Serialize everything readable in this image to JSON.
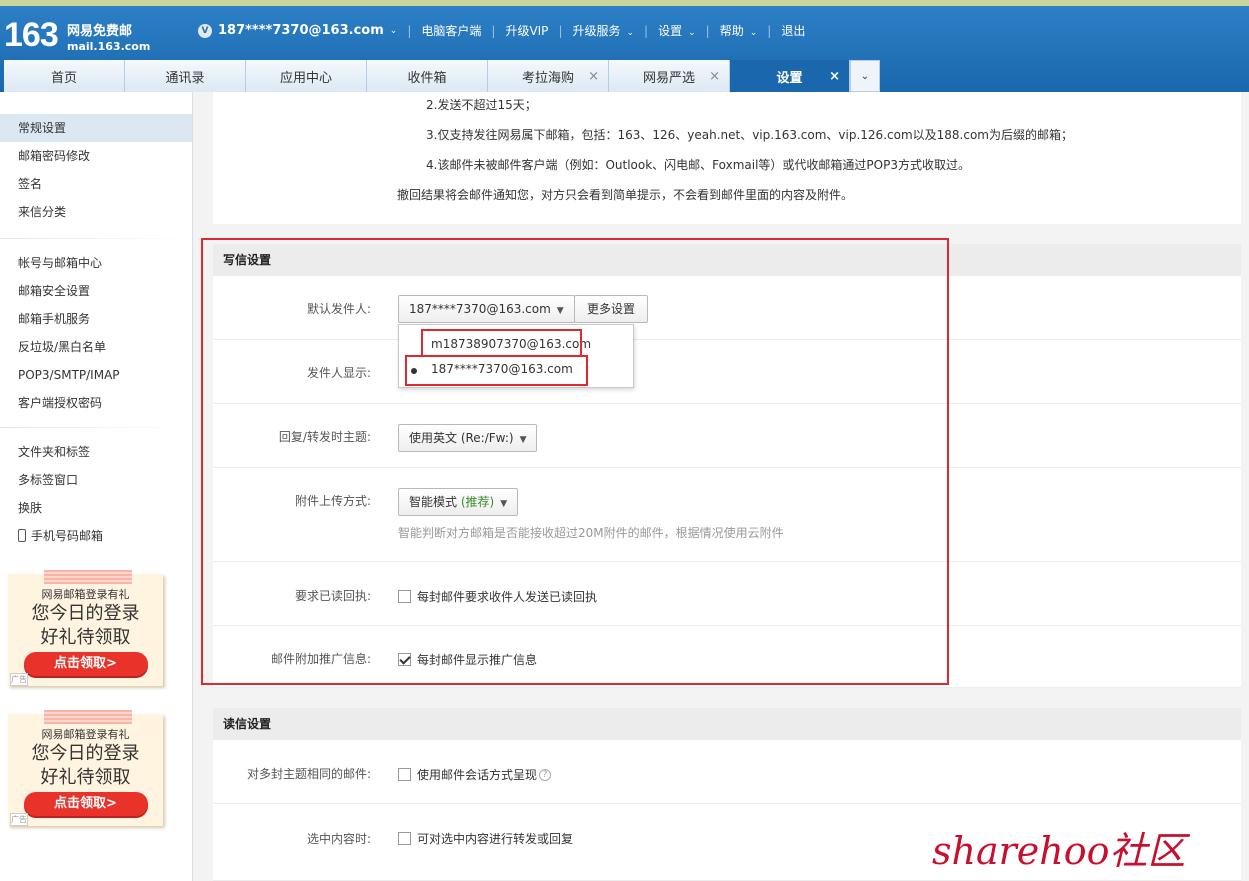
{
  "header": {
    "logo_num": "163",
    "logo_line1": "网易免费邮",
    "logo_line2": "mail.163.com",
    "vip_badge": "V",
    "account": "187****7370@163.com",
    "links": [
      "电脑客户端",
      "升级VIP",
      "升级服务",
      "设置",
      "帮助",
      "退出"
    ]
  },
  "tabs": [
    {
      "label": "首页",
      "closable": false
    },
    {
      "label": "通讯录",
      "closable": false
    },
    {
      "label": "应用中心",
      "closable": false
    },
    {
      "label": "收件箱",
      "closable": false
    },
    {
      "label": "考拉海购",
      "closable": true
    },
    {
      "label": "网易严选",
      "closable": true
    },
    {
      "label": "设置",
      "closable": true,
      "active": true
    }
  ],
  "tab_close_glyph": "×",
  "sidebar": {
    "group1": [
      "常规设置",
      "邮箱密码修改",
      "签名",
      "来信分类"
    ],
    "group2": [
      "帐号与邮箱中心",
      "邮箱安全设置",
      "邮箱手机服务",
      "反垃圾/黑白名单",
      "POP3/SMTP/IMAP",
      "客户端授权密码"
    ],
    "group3": [
      "文件夹和标签",
      "多标签窗口",
      "换肤",
      "手机号码邮箱"
    ]
  },
  "ads": [
    {
      "line1": "网易邮箱登录有礼",
      "line2": "您今日的登录",
      "line3": "好礼待领取",
      "button": "点击领取>",
      "tag": "广告"
    },
    {
      "line1": "网易邮箱登录有礼",
      "line2": "您今日的登录",
      "line3": "好礼待领取",
      "button": "点击领取>",
      "tag": "广告"
    }
  ],
  "recall_notes": {
    "n2": "2.发送不超过15天；",
    "n3": "3.仅支持发往网易属下邮箱，包括：163、126、yeah.net、vip.163.com、vip.126.com以及188.com为后缀的邮箱；",
    "n4": "4.该邮件未被邮件客户端（例如：Outlook、闪电邮、Foxmail等）或代收邮箱通过POP3方式收取过。",
    "summary": "撤回结果将会邮件通知您，对方只会看到简单提示，不会看到邮件里面的内容及附件。"
  },
  "compose": {
    "title": "写信设置",
    "default_sender_label": "默认发件人:",
    "default_sender_value": "187****7370@163.com",
    "more_settings": "更多设置",
    "sender_display_label": "发件人显示:",
    "dropdown_options": [
      "m18738907370@163.com",
      "187****7370@163.com"
    ],
    "reply_subject_label": "回复/转发时主题:",
    "reply_subject_value": "使用英文 (Re:/Fw:)",
    "attach_label": "附件上传方式:",
    "attach_value": "智能模式",
    "attach_recommend": "(推荐)",
    "attach_hint": "智能判断对方邮箱是否能接收超过20M附件的邮件，根据情况使用云附件",
    "receipt_label": "要求已读回执:",
    "receipt_text": "每封邮件要求收件人发送已读回执",
    "receipt_checked": false,
    "promo_label": "邮件附加推广信息:",
    "promo_text": "每封邮件显示推广信息",
    "promo_checked": true
  },
  "read": {
    "title": "读信设置",
    "thread_label": "对多封主题相同的邮件:",
    "thread_text": "使用邮件会话方式呈现",
    "help_glyph": "?",
    "select_label": "选中内容时:",
    "select_text": "可对选中内容进行转发或回复"
  },
  "watermark": "sharehoo社区",
  "colors": {
    "header_blue": "#1a67ad",
    "highlight_red": "#e0282e",
    "active_sidebar": "#dbe7f3"
  }
}
